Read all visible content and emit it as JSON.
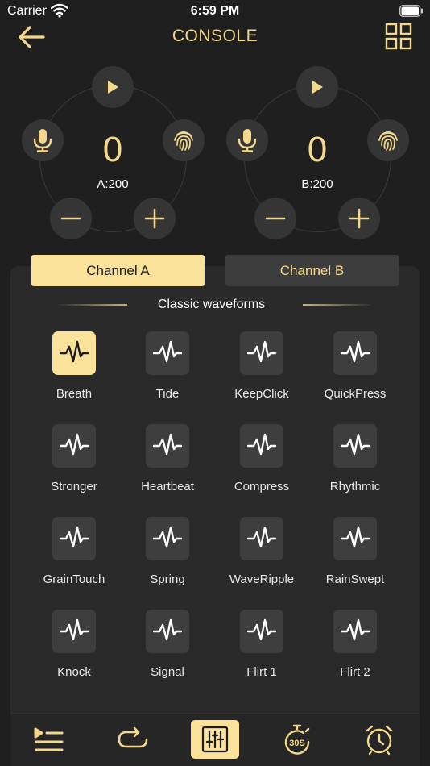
{
  "status_bar": {
    "carrier": "Carrier",
    "time": "6:59 PM"
  },
  "header": {
    "title": "CONSOLE"
  },
  "channels": {
    "a": {
      "value": "0",
      "limit": "A:200"
    },
    "b": {
      "value": "0",
      "limit": "B:200"
    }
  },
  "tabs": {
    "a": "Channel A",
    "b": "Channel B"
  },
  "section": {
    "title": "Classic waveforms"
  },
  "waveforms": [
    {
      "label": "Breath",
      "selected": true
    },
    {
      "label": "Tide"
    },
    {
      "label": "KeepClick"
    },
    {
      "label": "QuickPress"
    },
    {
      "label": "Stronger"
    },
    {
      "label": "Heartbeat"
    },
    {
      "label": "Compress"
    },
    {
      "label": "Rhythmic"
    },
    {
      "label": "GrainTouch"
    },
    {
      "label": "Spring"
    },
    {
      "label": "WaveRipple"
    },
    {
      "label": "RainSwept"
    },
    {
      "label": "Knock"
    },
    {
      "label": "Signal"
    },
    {
      "label": "Flirt 1"
    },
    {
      "label": "Flirt 2"
    }
  ],
  "bottom_tabs": {
    "items": [
      "list-icon",
      "repeat-icon",
      "mixer-icon",
      "timer-30s-icon",
      "alarm-clock-icon"
    ],
    "active": "mixer-icon",
    "timer_label": "30S"
  },
  "colors": {
    "accent": "#f4d98c",
    "accent_fill": "#fbe29a",
    "background": "#1f1f1f",
    "panel": "#2a2a2a",
    "tile": "#3e3e3e"
  }
}
